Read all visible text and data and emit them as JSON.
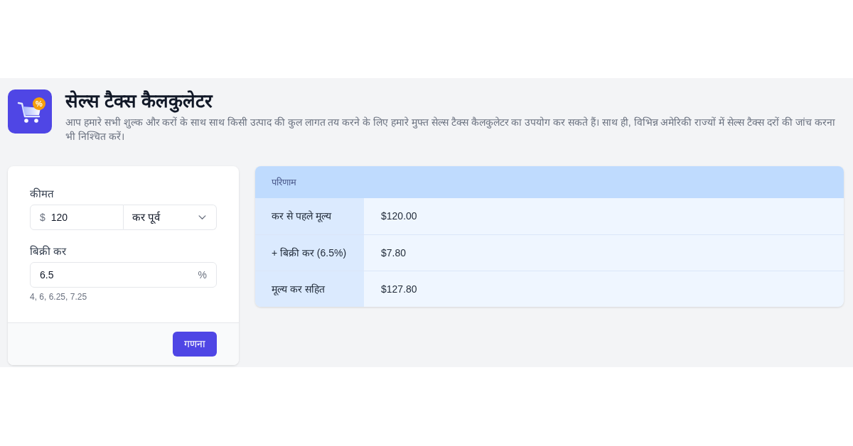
{
  "header": {
    "logo_badge": "%",
    "title": "सेल्स टैक्स कैलकुलेटर",
    "description": "आप हमारे सभी शुल्क और करों के साथ साथ किसी उत्पाद की कुल लागत तय करने के लिए हमारे मुफ्त सेल्स टैक्स कैलकुलेटर का उपयोग कर सकते हैं। साथ ही, विभिन्न अमेरिकी राज्यों में सेल्स टैक्स दरों की जांच करना भी निश्चित करें।"
  },
  "form": {
    "fields": [
      {
        "kind": "price",
        "label": "कीमत",
        "prefix": "$",
        "value": "120",
        "select": "कर पूर्व"
      },
      {
        "kind": "percent",
        "label": "बिक्री कर",
        "value": "6.5",
        "suffix": "%",
        "hint": "4, 6, 6.25, 7.25"
      }
    ],
    "button": "गणना"
  },
  "results": {
    "title": "परिणाम",
    "rows": [
      {
        "label": "कर से पहले मूल्य",
        "value": "$120.00"
      },
      {
        "label": "+ बिक्री कर (6.5%)",
        "value": "$7.80"
      },
      {
        "label": "मूल्य कर सहित",
        "value": "$127.80"
      }
    ]
  }
}
